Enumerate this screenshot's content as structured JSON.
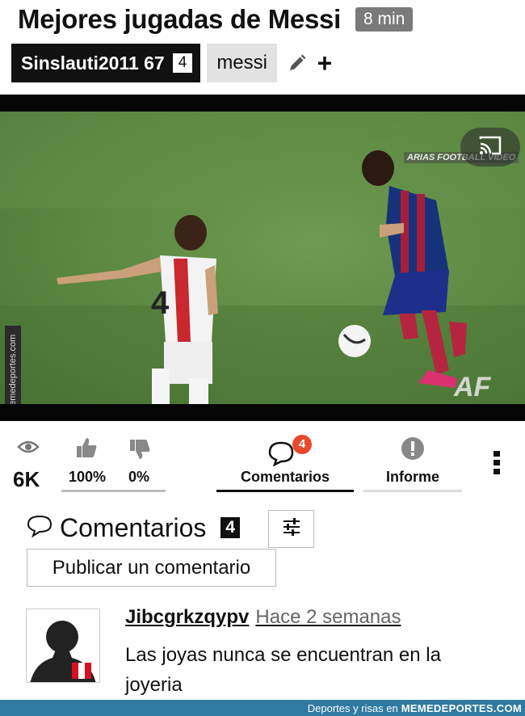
{
  "header": {
    "title": "Mejores jugadas de Messi",
    "duration": "8 min"
  },
  "meta": {
    "username": "Sinslauti2011 67",
    "user_count": "4",
    "tag": "messi",
    "edit_icon": "pencil-icon",
    "add_icon": "plus-icon"
  },
  "video": {
    "cast_icon": "cast-icon",
    "channel_watermark": "ARIAS FOOTBALL VIDEO",
    "corner_logo": "AF",
    "side_watermark": "Memedeportes.com"
  },
  "stats": {
    "views": "6K",
    "likes_pct": "100%",
    "dislikes_pct": "0%",
    "comments_label": "Comentarios",
    "comments_badge": "4",
    "report_label": "Informe",
    "accent_color": "#e8482e"
  },
  "comments": {
    "title": "Comentarios",
    "count": "4",
    "post_button": "Publicar un comentario",
    "items": [
      {
        "user": "Jibcgrkzqypv",
        "time": "Hace 2 semanas",
        "text": "Las joyas nunca se encuentran en la joyeria"
      }
    ]
  },
  "footer": {
    "prefix": "Deportes y risas en",
    "brand": "MEMEDEPORTES.COM"
  }
}
